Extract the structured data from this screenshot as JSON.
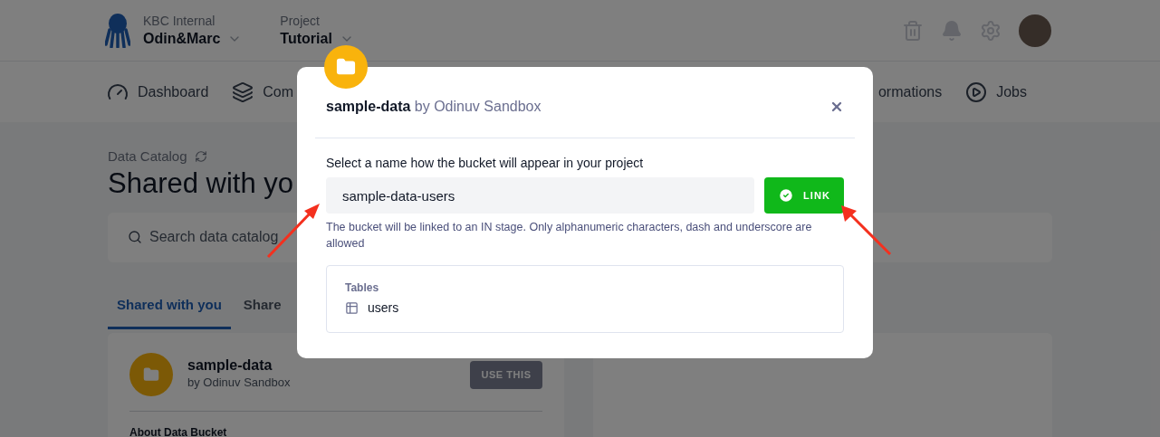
{
  "header": {
    "org_label": "KBC Internal",
    "org_name": "Odin&Marc",
    "project_label": "Project",
    "project_name": "Tutorial"
  },
  "nav_left": [
    {
      "label": "Dashboard"
    },
    {
      "label": "Com"
    }
  ],
  "nav_right": [
    {
      "label": "ormations"
    },
    {
      "label": "Jobs"
    }
  ],
  "page": {
    "breadcrumb": "Data Catalog",
    "title": "Shared with yo",
    "search_placeholder": "Search data catalog",
    "tabs": [
      {
        "label": "Shared with you",
        "selected": true
      },
      {
        "label": "Share",
        "selected": false
      }
    ],
    "card": {
      "name": "sample-data",
      "owner": "by Odinuv Sandbox",
      "button": "USE THIS",
      "section": "About Data Bucket"
    }
  },
  "modal": {
    "title": "sample-data",
    "owner": "by Odinuv Sandbox",
    "field_label": "Select a name how the bucket will appear in your project",
    "field_value": "sample-data-users",
    "button": "LINK",
    "help": "The bucket will be linked to an IN stage. Only alphanumeric characters, dash and underscore are allowed",
    "tables_label": "Tables",
    "tables": [
      "users"
    ]
  }
}
